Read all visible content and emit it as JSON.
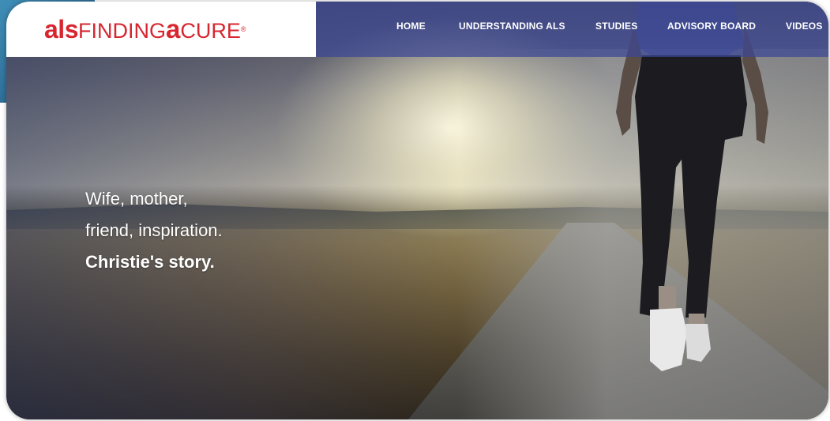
{
  "logo": {
    "als": "als",
    "finding": "FINDING",
    "a": "a",
    "cure": "CURE",
    "tm": "®"
  },
  "nav": {
    "items": [
      {
        "label": "HOME"
      },
      {
        "label": "UNDERSTANDING ALS"
      },
      {
        "label": "STUDIES"
      },
      {
        "label": "ADVISORY BOARD"
      },
      {
        "label": "VIDEOS"
      }
    ]
  },
  "hero": {
    "line1": "Wife, mother,",
    "line2": "friend, inspiration.",
    "line3": "Christie's story."
  },
  "colors": {
    "brand_red": "#d7262f",
    "nav_blue": "#3c4696"
  }
}
